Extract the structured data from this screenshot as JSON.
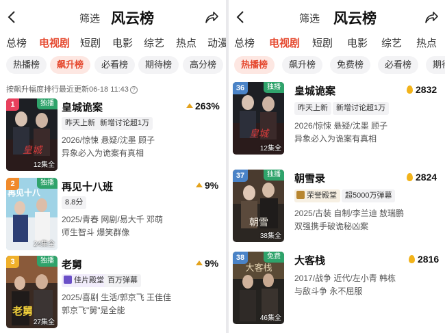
{
  "left": {
    "filter_label": "筛选",
    "title": "风云榜",
    "tabs": [
      "总榜",
      "电视剧",
      "短剧",
      "电影",
      "综艺",
      "热点",
      "动漫"
    ],
    "active_tab": "电视剧",
    "chips": [
      "热播榜",
      "飙升榜",
      "必看榜",
      "期待榜",
      "高分榜"
    ],
    "active_chip": "飙升榜",
    "update_text": "按飙升幅度排行最近更新06-18 11:43",
    "items": [
      {
        "rank": "1",
        "rank_color": "#e8405d",
        "status": "独播",
        "status_color": "#2fa36b",
        "title": "皇城诡案",
        "tags": [
          "昨天上新",
          "新增讨论超1万"
        ],
        "meta": "2026/惊悚 悬疑/沈墨 顾子",
        "desc": "异象必入为诡案有真相",
        "episodes": "12集全",
        "change": "263%"
      },
      {
        "rank": "2",
        "rank_color": "#f08a2b",
        "status": "独播",
        "status_color": "#2fa36b",
        "title": "再见十八班",
        "tags": [
          "8.8分"
        ],
        "meta": "2025/青春 网剧/易大千 邓萌",
        "desc": "师生智斗 爆笑群像",
        "episodes": "24集全",
        "change": "9%"
      },
      {
        "rank": "3",
        "rank_color": "#f0b02b",
        "status": "独播",
        "status_color": "#2fa36b",
        "title": "老舅",
        "tags": [
          "佳片殿堂",
          "百万弹幕"
        ],
        "meta": "2025/喜剧 生活/郭京飞 王佳佳",
        "desc": "郭京飞\"舅\"是全能",
        "episodes": "27集全",
        "change": "9%"
      }
    ]
  },
  "right": {
    "filter_label": "筛选",
    "title": "风云榜",
    "tabs": [
      "总榜",
      "电视剧",
      "短剧",
      "电影",
      "综艺",
      "热点"
    ],
    "active_tab": "电视剧",
    "chips": [
      "热播榜",
      "飙升榜",
      "免费榜",
      "必看榜",
      "期待"
    ],
    "active_chip": "热播榜",
    "items": [
      {
        "rank": "36",
        "rank_color": "#4a83c7",
        "status": "独播",
        "status_color": "#2fa36b",
        "title": "皇城诡案",
        "tags": [
          "昨天上新",
          "新增讨论超1万"
        ],
        "meta": "2026/惊悚 悬疑/沈墨 顾子",
        "desc": "异象必入为诡案有真相",
        "episodes": "12集全",
        "heat": "2832"
      },
      {
        "rank": "37",
        "rank_color": "#4a83c7",
        "status": "独播",
        "status_color": "#2fa36b",
        "title": "朝雪录",
        "tags": [
          "荣誉殿堂",
          "超5000万弹幕"
        ],
        "meta": "2025/古装 自制/李兰迪 敖瑞鹏",
        "desc": "双强携手破诡秘凶案",
        "episodes": "38集全",
        "heat": "2824"
      },
      {
        "rank": "38",
        "rank_color": "#4a83c7",
        "status": "免费",
        "status_color": "#2fa36b",
        "title": "大客栈",
        "tags": [],
        "meta": "2017/战争 近代/左小青 韩栋",
        "desc": "与敌斗争 永不屈服",
        "episodes": "46集全",
        "heat": "2816"
      }
    ]
  }
}
